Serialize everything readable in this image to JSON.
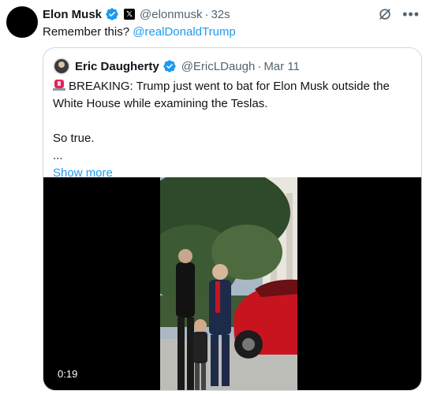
{
  "tweet": {
    "author_name": "Elon Musk",
    "handle": "@elonmusk",
    "separator": "·",
    "timestamp": "32s",
    "text": "Remember this? ",
    "mention": "@realDonaldTrump",
    "more_icon": "•••"
  },
  "quote": {
    "author_name": "Eric Daugherty",
    "handle": "@EricLDaugh",
    "separator": "·",
    "date": "Mar 11",
    "line1": "BREAKING: Trump just went to bat for Elon Musk outside the White House while examining the Teslas.",
    "line2": "So true.",
    "line3": "...",
    "show_more": "Show more"
  },
  "video": {
    "duration": "0:19"
  },
  "colors": {
    "accent": "#1d9bf0",
    "verified": "#1d9bf0",
    "alert": "#e0245e"
  }
}
